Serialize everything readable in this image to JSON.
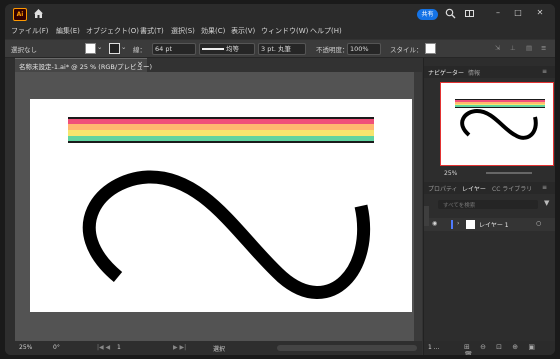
{
  "app": {
    "logo": "Ai",
    "share_label": "共有"
  },
  "menu": [
    "ファイル(F)",
    "編集(E)",
    "オブジェクト(O)",
    "書式(T)",
    "選択(S)",
    "効果(C)",
    "表示(V)",
    "ウィンドウ(W)",
    "ヘルプ(H)"
  ],
  "control_bar": {
    "selection": "選択なし",
    "stroke_label": "線：",
    "stroke_weight": "64 pt",
    "profile": "均等",
    "brush": "3 pt. 丸筆",
    "opacity_label": "不透明度：",
    "opacity": "100%",
    "style_label": "スタイル："
  },
  "document": {
    "tab_title": "名称未設定-1.ai* @ 25 % (RGB/プレビュー)",
    "close": "×"
  },
  "stripes": {
    "colors": [
      "#1a1a1a",
      "#f0507a",
      "#ffb870",
      "#f5e56e",
      "#5fd4a0",
      "#1a1a1a"
    ]
  },
  "status_bar": {
    "zoom": "25%",
    "rotation": "0°",
    "artboard": "1",
    "tool": "選択"
  },
  "right_panel": {
    "top_tabs": [
      "ナビゲーター",
      "情報"
    ],
    "nav_zoom": "25%",
    "mid_tabs": [
      "プロパティ",
      "レイヤー",
      "CC ライブラリ"
    ],
    "layer_name": "レイヤー 1",
    "search_placeholder": "すべてを検索",
    "bottom_label": "1 ..."
  },
  "colors": {
    "accent": "#1473e6",
    "selection_outline": "#e23232",
    "layer_color": "#4f7bff"
  }
}
